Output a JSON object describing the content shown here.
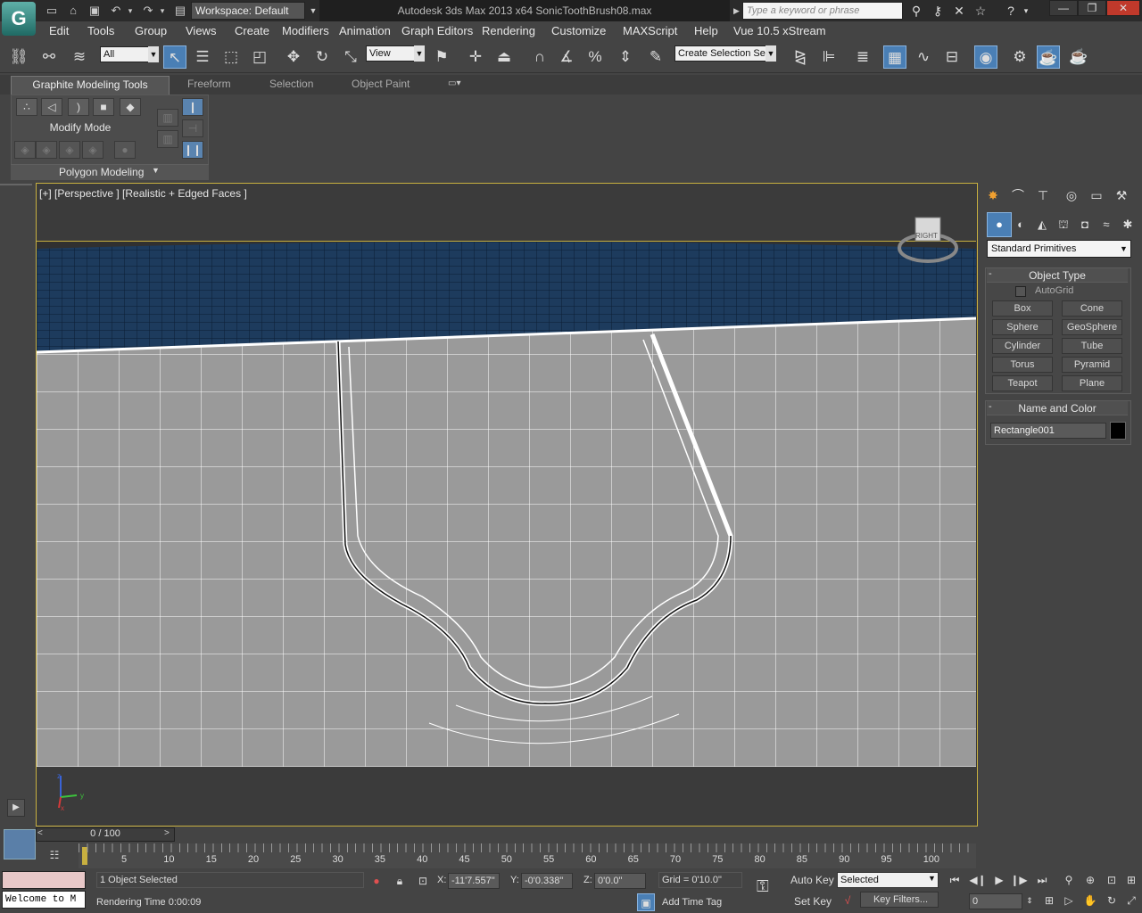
{
  "app": {
    "logo": "G",
    "workspace": "Workspace: Default",
    "window_title": "Autodesk 3ds Max  2013 x64     SonicToothBrush08.max",
    "search_placeholder": "Type a keyword or phrase"
  },
  "menus": [
    "Edit",
    "Tools",
    "Group",
    "Views",
    "Create",
    "Modifiers",
    "Animation",
    "Graph Editors",
    "Rendering",
    "Customize",
    "MAXScript",
    "Help",
    "Vue 10.5 xStream"
  ],
  "toolbar": {
    "selection_filter": "All",
    "ref_coord": "View",
    "named_selection": "Create Selection Se"
  },
  "ribbon": {
    "tabs": [
      "Graphite Modeling Tools",
      "Freeform",
      "Selection",
      "Object Paint"
    ],
    "panel_label": "Modify Mode",
    "panel_footer": "Polygon Modeling"
  },
  "viewport": {
    "label": "[+] [Perspective ] [Realistic + Edged Faces ]",
    "cube_label": "RIGHT",
    "axis_x": "x",
    "axis_y": "y",
    "axis_z": "z"
  },
  "command_panel": {
    "primitive_type": "Standard Primitives",
    "object_type_title": "Object Type",
    "autogrid_label": "AutoGrid",
    "buttons": [
      "Box",
      "Cone",
      "Sphere",
      "GeoSphere",
      "Cylinder",
      "Tube",
      "Torus",
      "Pyramid",
      "Teapot",
      "Plane"
    ],
    "name_color_title": "Name and Color",
    "object_name": "Rectangle001",
    "object_color": "#000000"
  },
  "time": {
    "slider_text": "0 / 100",
    "ticks": [
      "5",
      "10",
      "15",
      "20",
      "25",
      "30",
      "35",
      "40",
      "45",
      "50",
      "55",
      "60",
      "65",
      "70",
      "75",
      "80",
      "85",
      "90",
      "95",
      "100"
    ]
  },
  "status": {
    "maxscript_text": "Welcome to M",
    "selection_status": "1 Object Selected",
    "render_time": "Rendering Time  0:00:09",
    "x_label": "X:",
    "x_value": "-11'7.557\"",
    "y_label": "Y:",
    "y_value": "-0'0.338\"",
    "z_label": "Z:",
    "z_value": "0'0.0\"",
    "grid": "Grid = 0'10.0\"",
    "add_time_tag": "Add Time Tag",
    "auto_key": "Auto Key",
    "key_mode": "Selected",
    "set_key": "Set Key",
    "key_filters": "Key Filters...",
    "frame_value": "0"
  }
}
